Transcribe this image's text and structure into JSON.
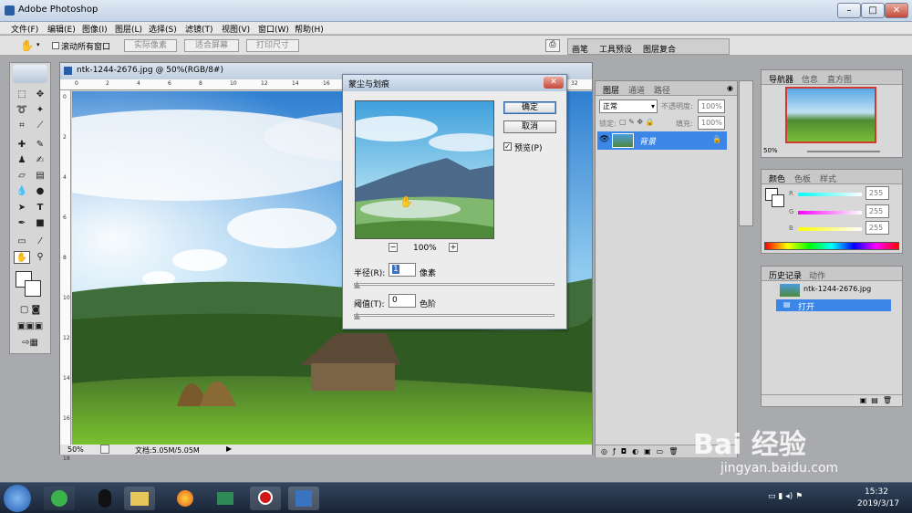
{
  "window": {
    "title": "Adobe Photoshop"
  },
  "menu": [
    "文件(F)",
    "编辑(E)",
    "图像(I)",
    "图层(L)",
    "选择(S)",
    "滤镜(T)",
    "视图(V)",
    "窗口(W)",
    "帮助(H)"
  ],
  "options": {
    "scroll_all": "滚动所有窗口",
    "actual_pixels": "实际像素",
    "fit_screen": "适合屏幕",
    "print_size": "打印尺寸"
  },
  "palette_well": {
    "tabs": [
      "画笔",
      "工具预设",
      "图层复合"
    ]
  },
  "document": {
    "title": "ntk-1244-2676.jpg @ 50%(RGB/8#)",
    "zoom": "50%",
    "doc_info": "文档:5.05M/5.05M",
    "ruler_top": [
      "0",
      "2",
      "4",
      "6",
      "8",
      "10",
      "12",
      "14",
      "16",
      "18",
      "20",
      "22",
      "24",
      "26",
      "28",
      "30",
      "32"
    ],
    "ruler_left": [
      "0",
      "2",
      "4",
      "6",
      "8",
      "10",
      "12",
      "14",
      "16",
      "18"
    ]
  },
  "dialog": {
    "title": "蒙尘与划痕",
    "ok": "确定",
    "cancel": "取消",
    "preview_label": "预览(P)",
    "preview_checked": true,
    "zoom": "100%",
    "zoom_out": "−",
    "zoom_in": "+",
    "radius_label": "半径(R):",
    "radius_value": "1",
    "radius_unit": "像素",
    "threshold_label": "阈值(T):",
    "threshold_value": "0",
    "threshold_unit": "色阶"
  },
  "layers": {
    "tabs": [
      "图层",
      "通道",
      "路径"
    ],
    "mode": "正常",
    "opacity_label": "不透明度:",
    "opacity": "100%",
    "lock_label": "锁定:",
    "fill_label": "填充:",
    "fill": "100%",
    "layer_name": "背景"
  },
  "navigator": {
    "tabs": [
      "导航器",
      "信息",
      "直方图"
    ],
    "zoom": "50%"
  },
  "color": {
    "tabs": [
      "颜色",
      "色板",
      "样式"
    ],
    "r_label": "R",
    "g_label": "G",
    "b_label": "B",
    "r": "255",
    "g": "255",
    "b": "255"
  },
  "history": {
    "tabs": [
      "历史记录",
      "动作"
    ],
    "source": "ntk-1244-2676.jpg",
    "step": "打开"
  },
  "taskbar": {
    "time": "15:32",
    "date": "2019/3/17"
  },
  "watermark": {
    "text": "Bai 经验",
    "url": "jingyan.baidu.com"
  }
}
